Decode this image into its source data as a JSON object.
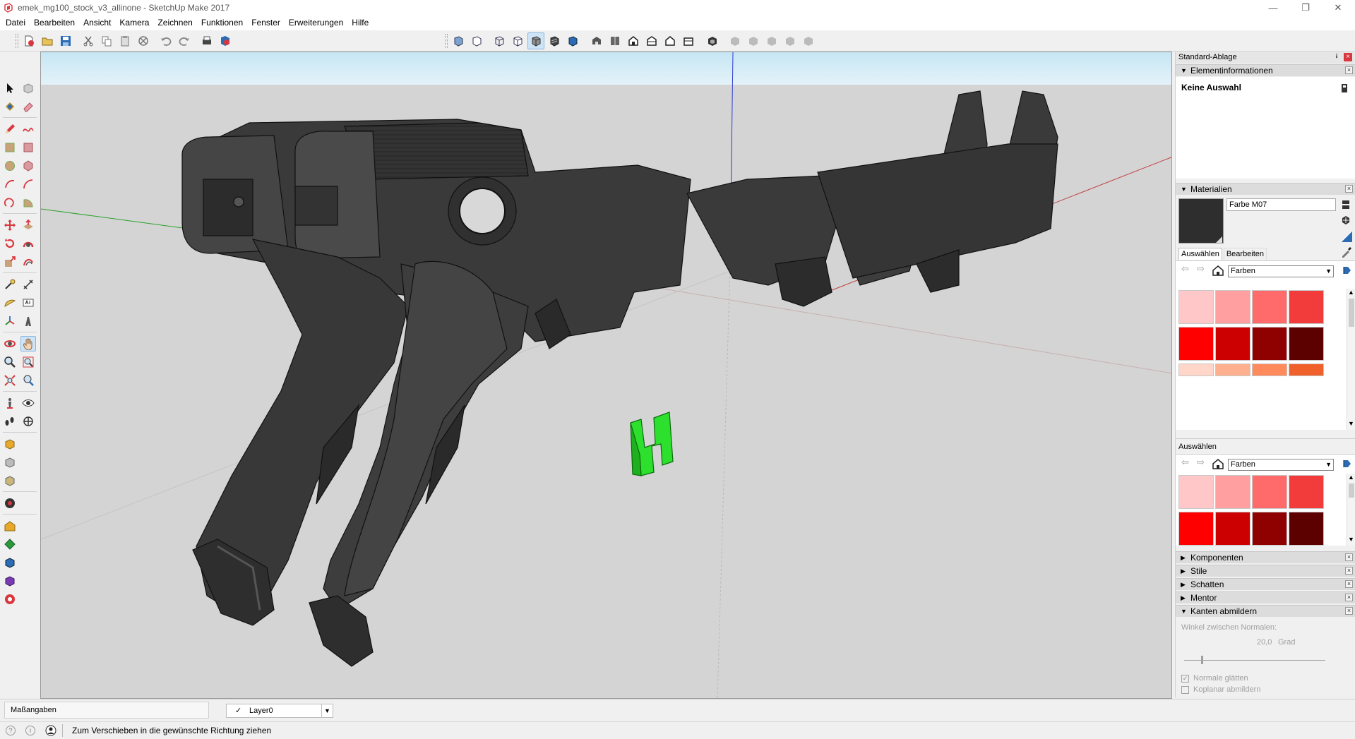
{
  "window": {
    "title": "emek_mg100_stock_v3_allinone - SketchUp Make 2017",
    "minimize_glyph": "—",
    "restore_glyph": "❐",
    "close_glyph": "✕"
  },
  "menu": [
    "Datei",
    "Bearbeiten",
    "Ansicht",
    "Kamera",
    "Zeichnen",
    "Funktionen",
    "Fenster",
    "Erweiterungen",
    "Hilfe"
  ],
  "tray": {
    "title": "Standard-Ablage",
    "pin_glyph": "⭭",
    "close_glyph": "×",
    "entity_info": {
      "heading": "Elementinformationen",
      "selection": "Keine Auswahl"
    },
    "materials": {
      "heading": "Materialien",
      "material_name": "Farbe M07",
      "current_color": "#2e2e2e",
      "tab_select": "Auswählen",
      "tab_edit": "Bearbeiten",
      "library": "Farben",
      "swatches": [
        "#ffc7c7",
        "#ff9f9f",
        "#ff6b6b",
        "#f23c3c",
        "#ff0000",
        "#cc0000",
        "#8f0000",
        "#5c0000",
        "#ffd6c7",
        "#ffb08f",
        "#ff8a5c",
        "#f0602a"
      ]
    },
    "secondary": {
      "heading": "Auswählen",
      "library": "Farben",
      "swatches": [
        "#ffc7c7",
        "#ff9f9f",
        "#ff6b6b",
        "#f23c3c",
        "#ff0000",
        "#cc0000",
        "#8f0000",
        "#5c0000"
      ]
    },
    "collapsed_panels": [
      "Komponenten",
      "Stile",
      "Schatten",
      "Mentor"
    ],
    "soften_edges": {
      "heading": "Kanten abmildern",
      "angle_label": "Winkel zwischen Normalen:",
      "angle_value": "20,0",
      "angle_unit": "Grad",
      "slider_fraction": 0.12,
      "smooth_normals": "Normale glätten",
      "smooth_normals_checked": true,
      "soften_coplanar": "Koplanar abmildern",
      "soften_coplanar_checked": false
    }
  },
  "measurements": {
    "label": "Maßangaben",
    "layer_check": "✓",
    "layer": "Layer0"
  },
  "status": {
    "message": "Zum Verschieben in die gewünschte Richtung ziehen"
  },
  "colors": {
    "sky": "#bfe3f2",
    "ground": "#d4d4d4",
    "model": "#3a3a3a",
    "highlight": "#28e028",
    "accent": "#cde4f7"
  },
  "icons": {
    "toolbar": [
      "new-icon",
      "open-icon",
      "save-icon",
      "cut-icon",
      "copy-icon",
      "paste-icon",
      "erase-icon",
      "undo-icon",
      "redo-icon",
      "print-icon",
      "model-info-icon"
    ],
    "views": [
      "xray-icon",
      "back-edges-icon",
      "wireframe-icon",
      "hidden-line-icon",
      "shaded-icon",
      "shaded-textures-icon",
      "monochrome-icon",
      "iso-view-icon",
      "top-view-icon",
      "front-view-icon",
      "right-view-icon",
      "back-view-icon",
      "left-view-icon",
      "3d-warehouse-icon",
      "share-model-icon",
      "get-models-icon",
      "extension-warehouse-icon",
      "layout-icon",
      "style-builder-icon"
    ]
  }
}
